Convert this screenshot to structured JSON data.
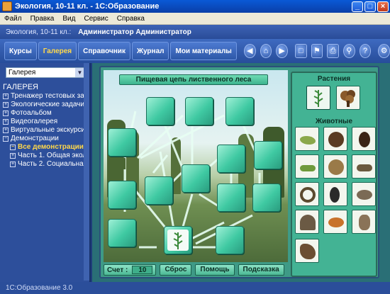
{
  "window": {
    "title": "Экология, 10-11 кл. - 1С:Образование",
    "buttons": {
      "minimize": "_",
      "maximize": "□",
      "close": "×"
    }
  },
  "menu": [
    "Файл",
    "Правка",
    "Вид",
    "Сервис",
    "Справка"
  ],
  "header": {
    "course": "Экология, 10-11 кл.:",
    "user": "Администратор Администратор"
  },
  "toolbar": {
    "tabs": [
      "Курсы",
      "Галерея",
      "Справочник",
      "Журнал",
      "Мои материалы"
    ],
    "active_tab": "Галерея",
    "icons": [
      "back-icon",
      "home-icon",
      "forward-icon",
      "crop-icon",
      "flag-icon",
      "print-icon",
      "search-icon",
      "help-icon",
      "settings-icon"
    ]
  },
  "sidebar": {
    "select_value": "Галерея",
    "root": "ГАЛЕРЕЯ",
    "items": [
      {
        "label": "Тренажер тестовых зада",
        "expander": "+",
        "level": 1
      },
      {
        "label": "Экологические задачи",
        "expander": "+",
        "level": 1
      },
      {
        "label": "Фотоальбом",
        "expander": "+",
        "level": 1
      },
      {
        "label": "Видеогалерея",
        "expander": "+",
        "level": 1
      },
      {
        "label": "Виртуальные экскурсии",
        "expander": "+",
        "level": 1
      },
      {
        "label": "Демонстрации",
        "expander": "−",
        "level": 1
      },
      {
        "label": "Все демонстрации",
        "expander": "−",
        "level": 2,
        "selected": true
      },
      {
        "label": "Часть 1. Общая экол",
        "expander": "+",
        "level": 2
      },
      {
        "label": "Часть 2. Социальная",
        "expander": "+",
        "level": 2
      }
    ]
  },
  "game": {
    "title": "Пищевая цепь лиственного леса",
    "score_label": "Счет :",
    "score_value": "10",
    "buttons": [
      "Сброс",
      "Помощь",
      "Подсказка"
    ],
    "plants_header": "Растения",
    "animals_header": "Животные",
    "plants": [
      "grass-icon",
      "oak-tree-icon"
    ],
    "animals": [
      "grasshopper-icon",
      "mole-icon",
      "beetle-icon",
      "caterpillar-icon",
      "frog-icon",
      "lizard-icon",
      "snake-icon",
      "magpie-icon",
      "bird-icon",
      "hedgehog-icon",
      "fox-icon",
      "owl-icon",
      "hawk-icon"
    ]
  },
  "status": "1С:Образование 3.0"
}
